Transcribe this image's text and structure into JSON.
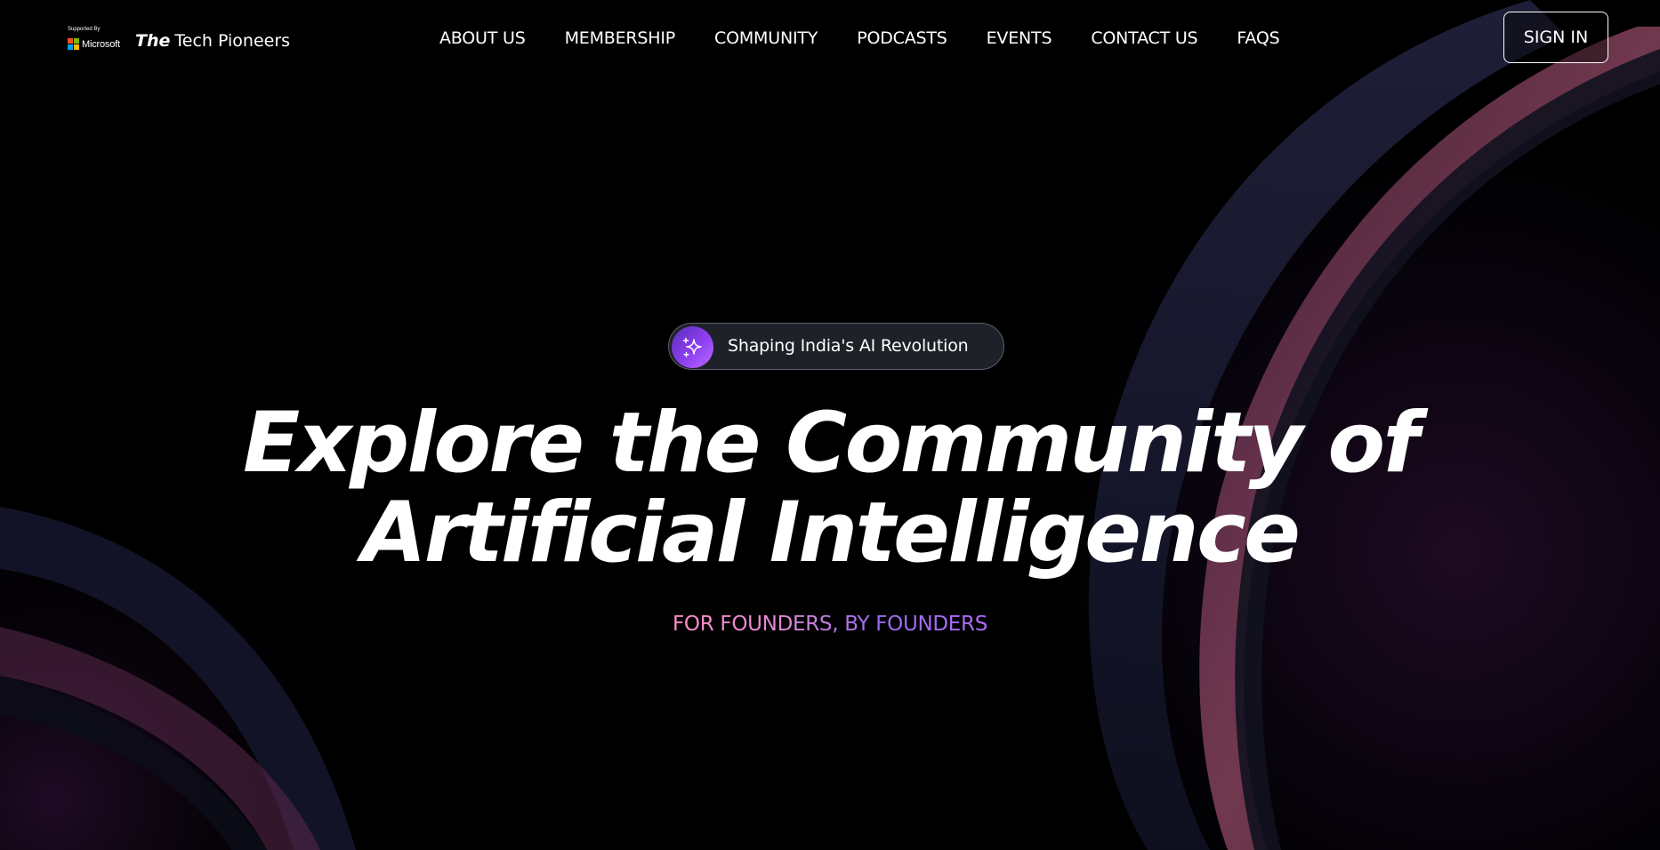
{
  "header": {
    "supported_by": "Supported By",
    "microsoft_label": "Microsoft",
    "brand_the": "The",
    "brand_name": "Tech Pioneers",
    "nav": [
      {
        "label": "ABOUT US"
      },
      {
        "label": "MEMBERSHIP"
      },
      {
        "label": "COMMUNITY"
      },
      {
        "label": "PODCASTS"
      },
      {
        "label": "EVENTS"
      },
      {
        "label": "CONTACT US"
      },
      {
        "label": "FAQS"
      }
    ],
    "signin_label": "SIGN IN"
  },
  "hero": {
    "badge_text": "Shaping India's AI Revolution",
    "badge_icon": "sparkles-icon",
    "headline_line1": "Explore the Community of",
    "headline_line2": "Artificial Intelligence",
    "tagline": "FOR FOUNDERS, BY FOUNDERS"
  },
  "colors": {
    "background": "#000000",
    "text": "#ffffff",
    "accent_purple": "#8d3ff0",
    "accent_pink": "#ff8ec8",
    "microsoft_red": "#f25022",
    "microsoft_green": "#7fba00",
    "microsoft_blue": "#00a4ef",
    "microsoft_yellow": "#ffb900"
  }
}
